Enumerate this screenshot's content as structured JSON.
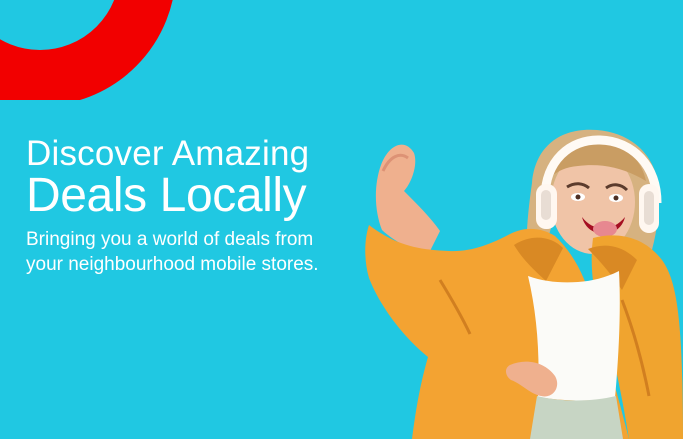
{
  "banner": {
    "headline_line1": "Discover Amazing",
    "headline_line2": "Deals Locally",
    "subtitle_line1": "Bringing you a world of deals from",
    "subtitle_line2": "your neighbourhood mobile stores."
  },
  "colors": {
    "background": "#20c8e2",
    "accent_red": "#f20000",
    "text": "#ffffff",
    "jacket": "#f3a332"
  },
  "icons": {
    "decorative_shape": "red-ring-arc"
  }
}
